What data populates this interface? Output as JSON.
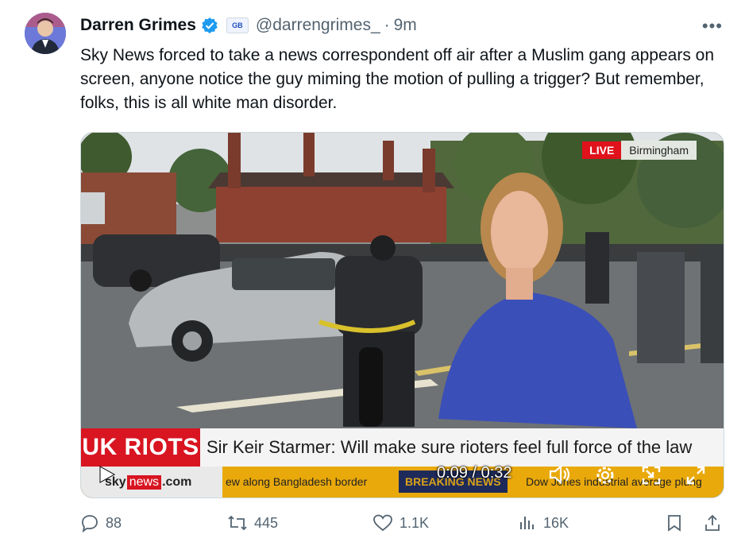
{
  "post": {
    "author_name": "Darren Grimes",
    "badge": "GB",
    "handle": "@darrengrimes_",
    "separator": "·",
    "time": "9m",
    "more": "•••",
    "text": "Sky News forced to take a news correspondent off air after a Muslim gang appears on screen, anyone notice the guy miming the motion of pulling a trigger? But remember, folks, this is all white man disorder."
  },
  "video": {
    "live_label": "LIVE",
    "location": "Birmingham",
    "section_tag": "UK RIOTS",
    "headline": "Sir Keir Starmer: Will make sure rioters feel full force of the law",
    "ticker_left": "ew along Bangladesh border",
    "ticker_breaking": "BREAKING NEWS",
    "ticker_right": "Dow Jones industrial average plung",
    "logo_sky": "sky",
    "logo_news": "news",
    "logo_com": ".com",
    "timecode": "0:09 / 0:32",
    "controls": [
      "play-icon",
      "volume-icon",
      "settings-icon",
      "pip-icon",
      "fullscreen-icon"
    ]
  },
  "actions": {
    "replies": "88",
    "reposts": "445",
    "likes": "1.1K",
    "views": "16K"
  },
  "colors": {
    "accent": "#1d9bf0",
    "live": "#e0121b",
    "ticker": "#e9a90b"
  }
}
